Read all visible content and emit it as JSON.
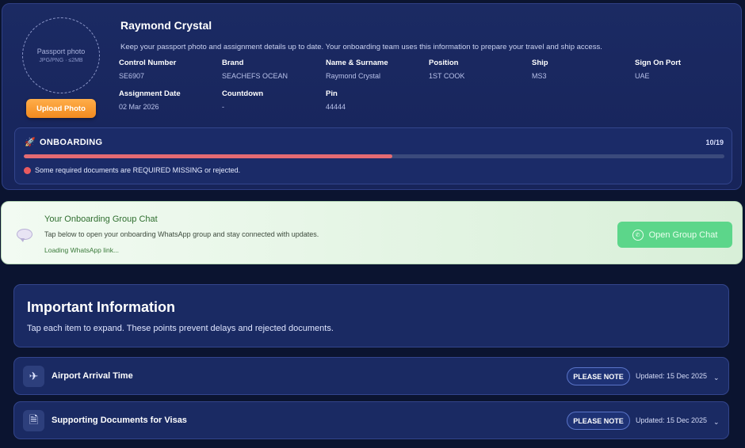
{
  "profile": {
    "photo_title": "Passport photo",
    "photo_sub": "JPG/PNG · ≤2MB",
    "upload_label": "Upload Photo",
    "name": "Raymond Crystal",
    "intro": "Keep your passport photo and assignment details up to date. Your onboarding team uses this information to prepare your travel and ship access.",
    "fields": [
      {
        "label": "Control Number",
        "value": "SE6907"
      },
      {
        "label": "Brand",
        "value": "SEACHEFS OCEAN"
      },
      {
        "label": "Name & Surname",
        "value": "Raymond Crystal"
      },
      {
        "label": "Position",
        "value": "1ST COOK"
      },
      {
        "label": "Ship",
        "value": "MS3"
      },
      {
        "label": "Sign On Port",
        "value": "UAE"
      },
      {
        "label": "Assignment Date",
        "value": "02 Mar 2026"
      },
      {
        "label": "Countdown",
        "value": "-"
      },
      {
        "label": "Pin",
        "value": "44444"
      }
    ]
  },
  "onboarding": {
    "title": "ONBOARDING",
    "count": "10/19",
    "progress": 0.526,
    "warning": "Some required documents are REQUIRED MISSING or rejected.",
    "accent": "#e46b73"
  },
  "chat": {
    "title": "Your Onboarding Group Chat",
    "desc": "Tap below to open your onboarding WhatsApp group and stay connected with updates.",
    "loading": "Loading WhatsApp link...",
    "button_label": "Open Group Chat"
  },
  "info": {
    "title": "Important Information",
    "subtitle": "Tap each item to expand. These points prevent delays and rejected documents.",
    "items": [
      {
        "icon": "plane-icon",
        "title": "Airport Arrival Time",
        "badge": "PLEASE NOTE",
        "updated": "Updated: 15 Dec 2025"
      },
      {
        "icon": "document-icon",
        "title": "Supporting Documents for Visas",
        "badge": "PLEASE NOTE",
        "updated": "Updated: 15 Dec 2025"
      }
    ]
  }
}
